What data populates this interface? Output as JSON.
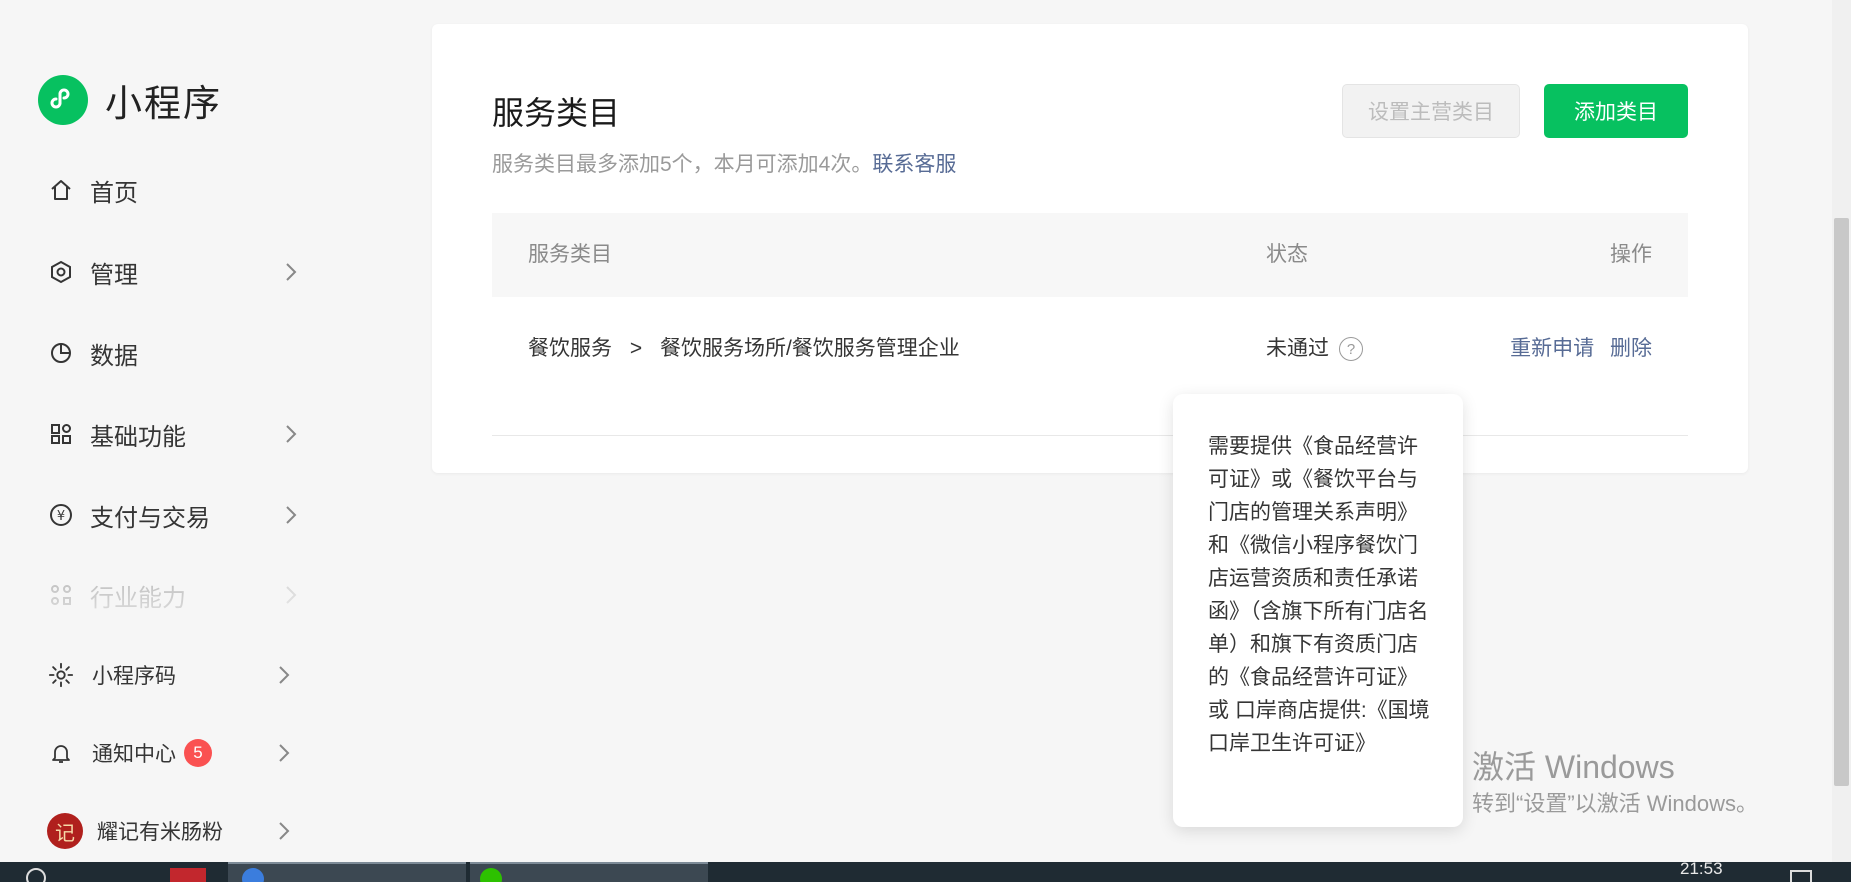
{
  "app": {
    "title": "小程序"
  },
  "sidebar": {
    "items": [
      {
        "label": "首页",
        "icon": "home-icon",
        "chevron": false
      },
      {
        "label": "管理",
        "icon": "hexagon-icon",
        "chevron": true
      },
      {
        "label": "数据",
        "icon": "pie-chart-icon",
        "chevron": false
      },
      {
        "label": "基础功能",
        "icon": "grid-icon",
        "chevron": true
      },
      {
        "label": "支付与交易",
        "icon": "yuan-icon",
        "chevron": true
      },
      {
        "label": "行业能力",
        "icon": "industry-icon",
        "chevron": true
      }
    ],
    "bottom": {
      "code": {
        "label": "小程序码",
        "icon": "qrcode-sun-icon"
      },
      "notify": {
        "label": "通知中心",
        "badge": "5",
        "icon": "bell-icon"
      },
      "account": {
        "label": "耀记有米肠粉",
        "avatar_text": "记"
      }
    }
  },
  "main": {
    "title": "服务类目",
    "subtitle": "服务类目最多添加5个，本月可添加4次。",
    "contact_link": "联系客服",
    "set_main_button": "设置主营类目",
    "add_button": "添加类目",
    "columns": {
      "category": "服务类目",
      "status": "状态",
      "action": "操作"
    },
    "rows": [
      {
        "category": "餐饮服务",
        "separator": ">",
        "subcategory": "餐饮服务场所/餐饮服务管理企业",
        "status": "未通过",
        "help": "?",
        "action_reapply": "重新申请",
        "action_delete": "删除"
      }
    ]
  },
  "tooltip": {
    "text": "需要提供《食品经营许可证》或《餐饮平台与门店的管理关系声明》和《微信小程序餐饮门店运营资质和责任承诺函》（含旗下所有门店名单）和旗下有资质门店的《食品经营许可证》或 口岸商店提供:《国境口岸卫生许可证》"
  },
  "watermark": {
    "line1": "激活 Windows",
    "line2": "转到“设置”以激活 Windows。"
  },
  "taskbar": {
    "clock": "21:53"
  },
  "colors": {
    "brand": "#07c160",
    "link": "#576b95",
    "badge": "#fa5151"
  }
}
